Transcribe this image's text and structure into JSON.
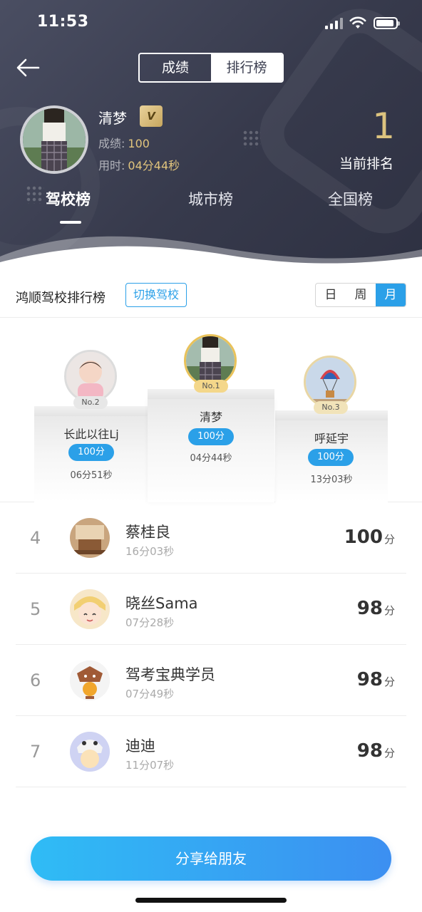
{
  "status_bar": {
    "time": "11:53"
  },
  "header": {
    "tabs": [
      "成绩",
      "排行榜"
    ],
    "active_tab": "排行榜",
    "user": {
      "name": "清梦",
      "vip_badge": "V",
      "score_label": "成绩:",
      "score": "100",
      "time_label": "用时:",
      "time": "04分44秒"
    },
    "rank": "1",
    "rank_label": "当前排名",
    "categories": [
      "驾校榜",
      "城市榜",
      "全国榜"
    ],
    "active_category": "驾校榜"
  },
  "school_bar": {
    "title": "鸿顺驾校排行榜",
    "switch_label": "切换驾校",
    "periods": [
      "日",
      "周",
      "月"
    ],
    "active_period": "月"
  },
  "podium": [
    {
      "tag": "No.2",
      "name": "长此以往Lj",
      "score": "100分",
      "time": "06分51秒"
    },
    {
      "tag": "No.1",
      "name": "清梦",
      "score": "100分",
      "time": "04分44秒"
    },
    {
      "tag": "No.3",
      "name": "呼延宇",
      "score": "100分",
      "time": "13分03秒"
    }
  ],
  "list": [
    {
      "rank": "4",
      "name": "蔡桂良",
      "time": "16分03秒",
      "score": "100",
      "unit": "分"
    },
    {
      "rank": "5",
      "name": "晓丝Sama",
      "time": "07分28秒",
      "score": "98",
      "unit": "分"
    },
    {
      "rank": "6",
      "name": "驾考宝典学员",
      "time": "07分49秒",
      "score": "98",
      "unit": "分"
    },
    {
      "rank": "7",
      "name": "迪迪",
      "time": "11分07秒",
      "score": "98",
      "unit": "分"
    }
  ],
  "share_label": "分享给朋友",
  "colors": {
    "accent": "#2ba0e8",
    "header_bg": "#3a3d4f",
    "gold": "#dcc37f"
  }
}
